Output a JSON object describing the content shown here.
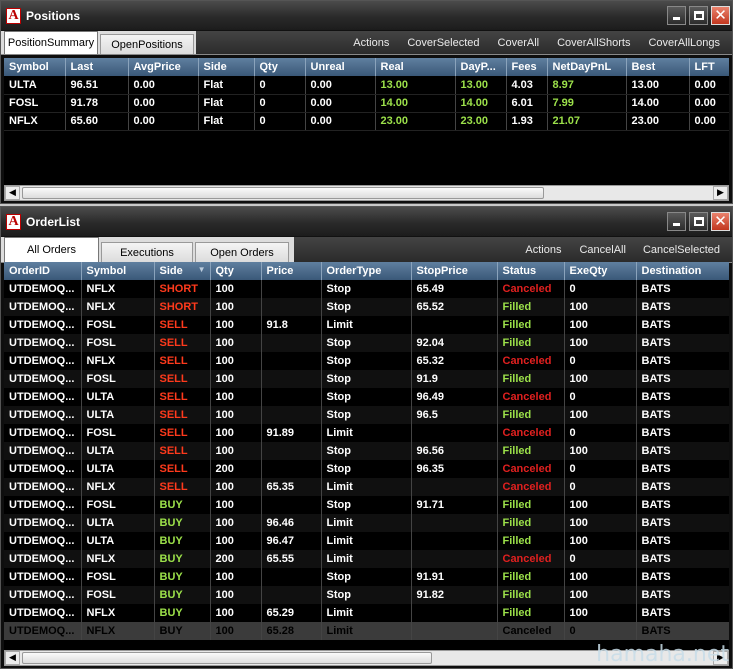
{
  "positions_window": {
    "title": "Positions",
    "tabs": [
      "PositionSummary",
      "OpenPositions"
    ],
    "actions": [
      "Actions",
      "CoverSelected",
      "CoverAll",
      "CoverAllShorts",
      "CoverAllLongs"
    ],
    "columns": [
      "Symbol",
      "Last",
      "AvgPrice",
      "Side",
      "Qty",
      "Unreal",
      "Real",
      "DayP...",
      "Fees",
      "NetDayPnL",
      "Best",
      "LFT"
    ],
    "rows": [
      [
        "ULTA",
        "96.51",
        "0.00",
        "Flat",
        "0",
        "0.00",
        "13.00",
        "13.00",
        "4.03",
        "8.97",
        "13.00",
        "0.00"
      ],
      [
        "FOSL",
        "91.78",
        "0.00",
        "Flat",
        "0",
        "0.00",
        "14.00",
        "14.00",
        "6.01",
        "7.99",
        "14.00",
        "0.00"
      ],
      [
        "NFLX",
        "65.60",
        "0.00",
        "Flat",
        "0",
        "0.00",
        "23.00",
        "23.00",
        "1.93",
        "21.07",
        "23.00",
        "0.00"
      ]
    ]
  },
  "orders_window": {
    "title": "OrderList",
    "tabs": [
      "All Orders",
      "Executions",
      "Open Orders"
    ],
    "actions": [
      "Actions",
      "CancelAll",
      "CancelSelected"
    ],
    "columns": [
      "OrderID",
      "Symbol",
      "Side",
      "Qty",
      "Price",
      "OrderType",
      "StopPrice",
      "Status",
      "ExeQty",
      "Destination"
    ],
    "rows": [
      [
        "UTDEMOQ...",
        "NFLX",
        "SHORT",
        "100",
        "",
        "Stop",
        "65.49",
        "Canceled",
        "0",
        "BATS"
      ],
      [
        "UTDEMOQ...",
        "NFLX",
        "SHORT",
        "100",
        "",
        "Stop",
        "65.52",
        "Filled",
        "100",
        "BATS"
      ],
      [
        "UTDEMOQ...",
        "FOSL",
        "SELL",
        "100",
        "91.8",
        "Limit",
        "",
        "Filled",
        "100",
        "BATS"
      ],
      [
        "UTDEMOQ...",
        "FOSL",
        "SELL",
        "100",
        "",
        "Stop",
        "92.04",
        "Filled",
        "100",
        "BATS"
      ],
      [
        "UTDEMOQ...",
        "NFLX",
        "SELL",
        "100",
        "",
        "Stop",
        "65.32",
        "Canceled",
        "0",
        "BATS"
      ],
      [
        "UTDEMOQ...",
        "FOSL",
        "SELL",
        "100",
        "",
        "Stop",
        "91.9",
        "Filled",
        "100",
        "BATS"
      ],
      [
        "UTDEMOQ...",
        "ULTA",
        "SELL",
        "100",
        "",
        "Stop",
        "96.49",
        "Canceled",
        "0",
        "BATS"
      ],
      [
        "UTDEMOQ...",
        "ULTA",
        "SELL",
        "100",
        "",
        "Stop",
        "96.5",
        "Filled",
        "100",
        "BATS"
      ],
      [
        "UTDEMOQ...",
        "FOSL",
        "SELL",
        "100",
        "91.89",
        "Limit",
        "",
        "Canceled",
        "0",
        "BATS"
      ],
      [
        "UTDEMOQ...",
        "ULTA",
        "SELL",
        "100",
        "",
        "Stop",
        "96.56",
        "Filled",
        "100",
        "BATS"
      ],
      [
        "UTDEMOQ...",
        "ULTA",
        "SELL",
        "200",
        "",
        "Stop",
        "96.35",
        "Canceled",
        "0",
        "BATS"
      ],
      [
        "UTDEMOQ...",
        "NFLX",
        "SELL",
        "100",
        "65.35",
        "Limit",
        "",
        "Canceled",
        "0",
        "BATS"
      ],
      [
        "UTDEMOQ...",
        "FOSL",
        "BUY",
        "100",
        "",
        "Stop",
        "91.71",
        "Filled",
        "100",
        "BATS"
      ],
      [
        "UTDEMOQ...",
        "ULTA",
        "BUY",
        "100",
        "96.46",
        "Limit",
        "",
        "Filled",
        "100",
        "BATS"
      ],
      [
        "UTDEMOQ...",
        "ULTA",
        "BUY",
        "100",
        "96.47",
        "Limit",
        "",
        "Filled",
        "100",
        "BATS"
      ],
      [
        "UTDEMOQ...",
        "NFLX",
        "BUY",
        "200",
        "65.55",
        "Limit",
        "",
        "Canceled",
        "0",
        "BATS"
      ],
      [
        "UTDEMOQ...",
        "FOSL",
        "BUY",
        "100",
        "",
        "Stop",
        "91.91",
        "Filled",
        "100",
        "BATS"
      ],
      [
        "UTDEMOQ...",
        "FOSL",
        "BUY",
        "100",
        "",
        "Stop",
        "91.82",
        "Filled",
        "100",
        "BATS"
      ],
      [
        "UTDEMOQ...",
        "NFLX",
        "BUY",
        "100",
        "65.29",
        "Limit",
        "",
        "Filled",
        "100",
        "BATS"
      ],
      [
        "UTDEMOQ...",
        "NFLX",
        "BUY",
        "100",
        "65.28",
        "Limit",
        "",
        "Canceled",
        "0",
        "BATS"
      ]
    ],
    "sort_indicator": "▼"
  },
  "colors": {
    "buy": "#9ce14a",
    "sell": "#ff3a1c",
    "filled": "#9ce14a",
    "canceled": "#e0201f",
    "header": "#4a6a8a"
  },
  "watermark": "hamaha.net"
}
